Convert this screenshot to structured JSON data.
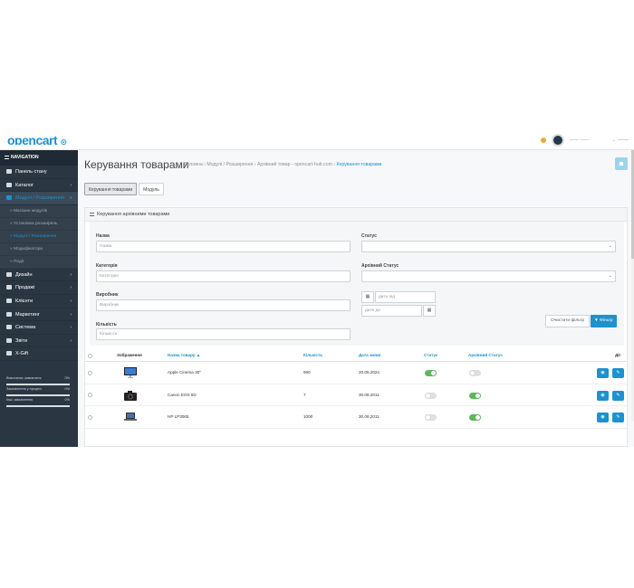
{
  "header": {
    "logo": "opencart",
    "logo_suffix": "⊙",
    "user_name": "—— ——",
    "logout": "→ ——"
  },
  "sidebar": {
    "nav_title": "NAVIGATION",
    "items": [
      {
        "label": "Панель стану",
        "icon": "dashboard-icon",
        "arrow": ""
      },
      {
        "label": "Каталог",
        "icon": "tag-icon",
        "arrow": "›"
      },
      {
        "label": "Модулі / Розширення",
        "icon": "puzzle-icon",
        "arrow": "›"
      },
      {
        "label": "Дизайн",
        "icon": "monitor-icon",
        "arrow": "›"
      },
      {
        "label": "Продажі",
        "icon": "cart-icon",
        "arrow": "›"
      },
      {
        "label": "Клієнти",
        "icon": "user-icon",
        "arrow": "›"
      },
      {
        "label": "Маркетинг",
        "icon": "share-icon",
        "arrow": "›"
      },
      {
        "label": "Система",
        "icon": "gear-icon",
        "arrow": "›"
      },
      {
        "label": "Звіти",
        "icon": "chart-icon",
        "arrow": "›"
      },
      {
        "label": "X-Gift",
        "icon": "gift-icon",
        "arrow": ""
      }
    ],
    "subitems": [
      "» Магазин модулів",
      "» Установка розширень",
      "» Модулі / Розширення",
      "» Модифікатори",
      "» Події"
    ],
    "stats": [
      {
        "label": "Виконаних замовлень",
        "pct": "0%"
      },
      {
        "label": "Замовлення у процесі",
        "pct": "0%"
      },
      {
        "label": "Інші замовлення",
        "pct": "0%"
      }
    ]
  },
  "page": {
    "title": "Керування товарами",
    "breadcrumb": [
      "Головна",
      "Модулі / Розширення",
      "Архівний товар - opencart-hub.com"
    ],
    "breadcrumb_current": "Керування товарами",
    "tabs": [
      "Керування товарами",
      "Модуль"
    ]
  },
  "panel": {
    "title": "Керування архівними товарами",
    "filter": {
      "name_label": "Назва",
      "name_placeholder": "Назва",
      "category_label": "Категорія",
      "category_placeholder": "Категорія",
      "manufacturer_label": "Виробник",
      "manufacturer_placeholder": "Виробник",
      "quantity_label": "Кількість",
      "quantity_placeholder": "Кількість",
      "status_label": "Статус",
      "status_value": "",
      "archive_status_label": "Архівний Статус",
      "archive_status_value": "",
      "date_from_placeholder": "дата від",
      "date_to_placeholder": "дата до",
      "clear_button": "Очистити фільтр",
      "filter_button": "▼ Фільтр"
    },
    "table": {
      "headers": {
        "image": "Зображення",
        "name": "Назва товару ▲",
        "quantity": "Кількість",
        "date": "Дата зміни",
        "status": "Статус",
        "archive_status": "Архівний Статус",
        "action": "Дії"
      },
      "rows": [
        {
          "name": "Apple Cinema 30\"",
          "quantity": "990",
          "date": "20.05.2024",
          "status": true,
          "archive": false,
          "image": "monitor"
        },
        {
          "name": "Canon EOS 5D",
          "quantity": "7",
          "date": "30.08.2011",
          "status": false,
          "archive": true,
          "image": "camera"
        },
        {
          "name": "HP LP3065",
          "quantity": "1000",
          "date": "30.08.2011",
          "status": false,
          "archive": true,
          "image": "laptop"
        }
      ]
    }
  },
  "colors": {
    "accent": "#1e91cf",
    "sidebar": "#2a3642",
    "toggle_on": "#5cb85c"
  }
}
